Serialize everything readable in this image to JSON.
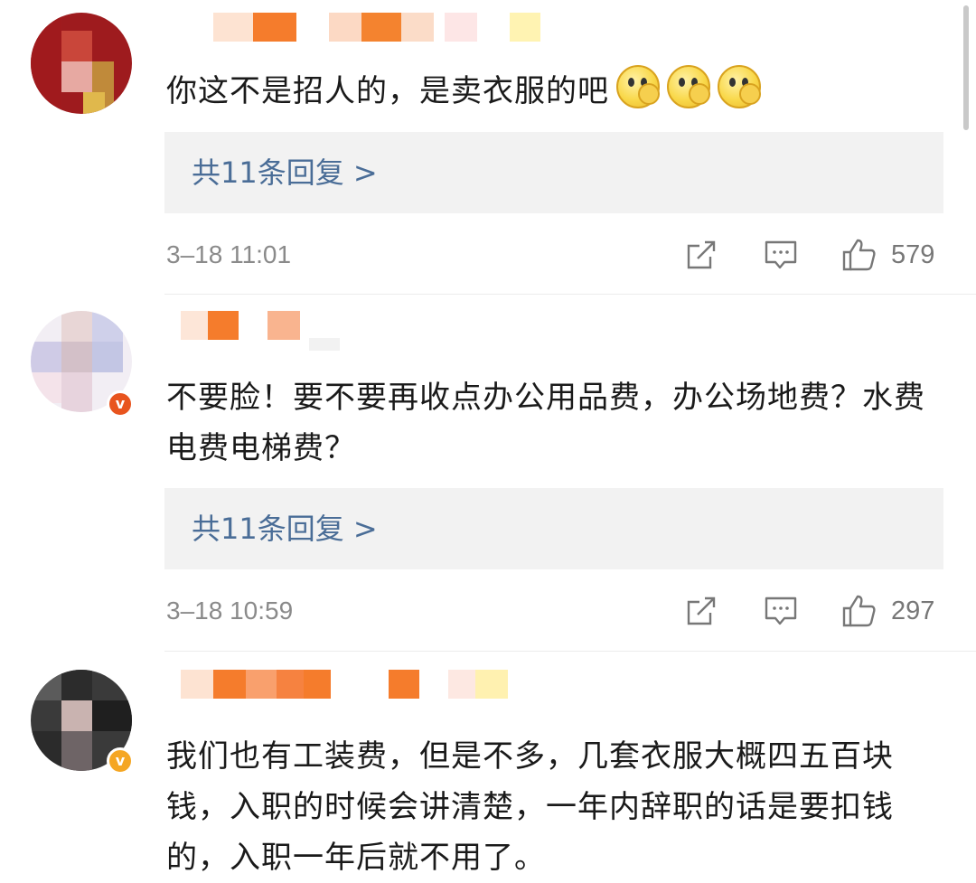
{
  "comments": [
    {
      "text": "你这不是招人的，是卖衣服的吧",
      "emojis": [
        "thinking-emoji",
        "thinking-emoji",
        "thinking-emoji"
      ],
      "reply_label": "共11条回复 >",
      "time": "3–18 11:01",
      "likes": "579",
      "verified": false
    },
    {
      "text": "不要脸！要不要再收点办公用品费，办公场地费？水费电费电梯费？",
      "reply_label": "共11条回复 >",
      "time": "3–18 10:59",
      "likes": "297",
      "verified": true,
      "badge_color": "#e8541e"
    },
    {
      "text": "我们也有工装费，但是不多，几套衣服大概四五百块钱，入职的时候会讲清楚，一年内辞职的话是要扣钱的，入职一年后就不用了。",
      "verified": true,
      "badge_color": "#f5a623"
    }
  ],
  "icons": {
    "share": "share-icon",
    "comment": "comment-icon",
    "like": "thumbs-up-icon",
    "verified": "verified-v-icon"
  },
  "colors": {
    "reply_link": "#4a6d97",
    "reply_bg": "#f2f2f2",
    "meta_text": "#8a8a8a"
  }
}
